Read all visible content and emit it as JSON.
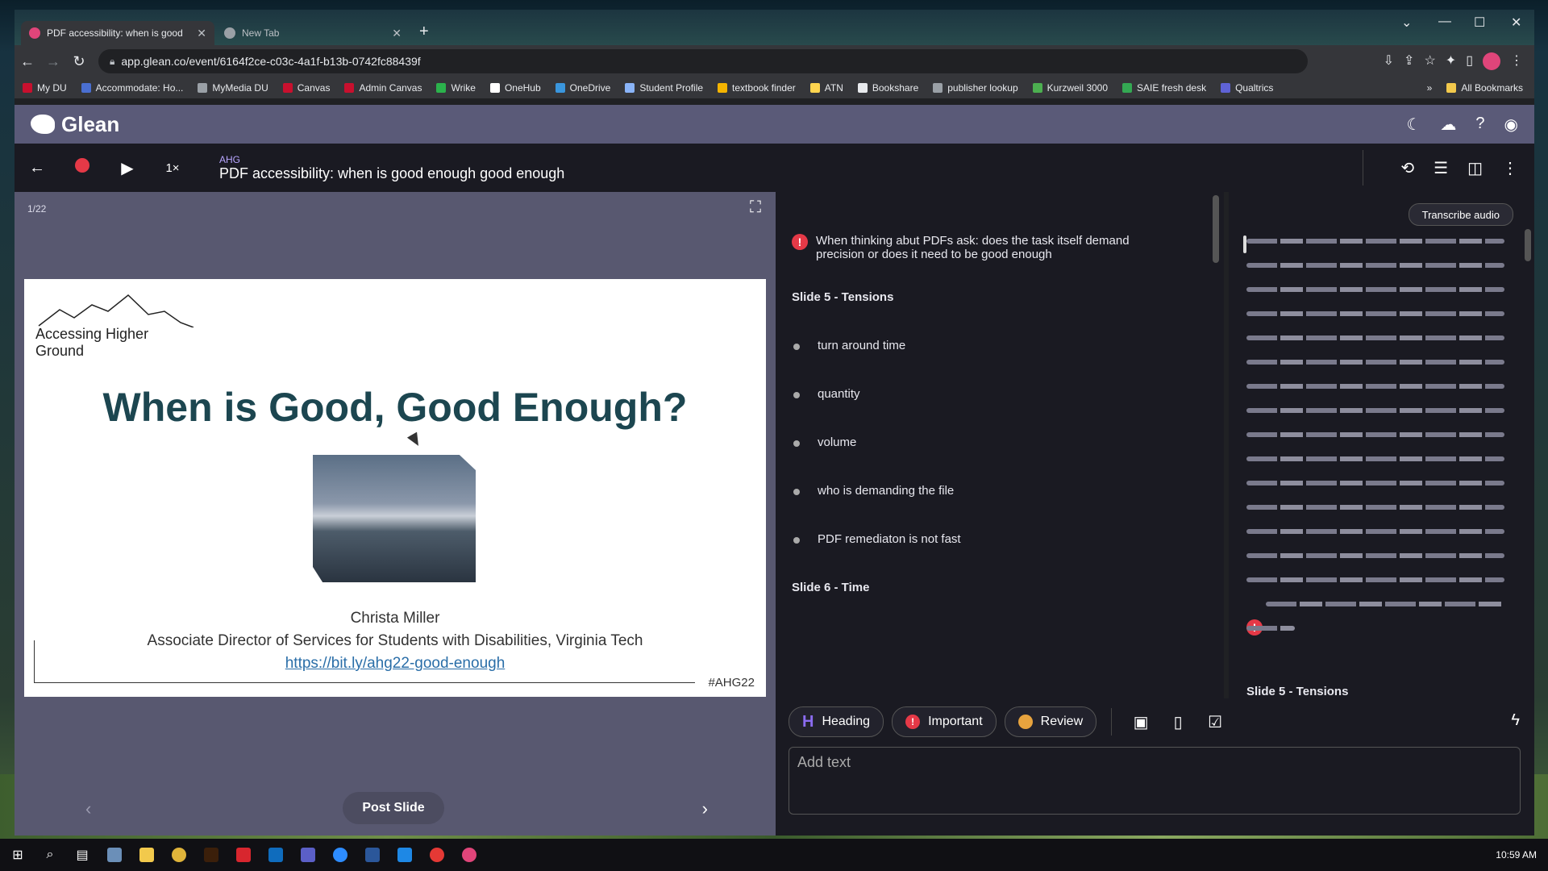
{
  "browser": {
    "tabs": [
      {
        "title": "PDF accessibility: when is good",
        "active": true
      },
      {
        "title": "New Tab",
        "active": false
      }
    ],
    "url": "app.glean.co/event/6164f2ce-c03c-4a1f-b13b-0742fc88439f",
    "bookmarks": [
      "My DU",
      "Accommodate: Ho...",
      "MyMedia DU",
      "Canvas",
      "Admin Canvas",
      "Wrike",
      "OneHub",
      "OneDrive",
      "Student Profile",
      "textbook finder",
      "ATN",
      "Bookshare",
      "publisher lookup",
      "Kurzweil 3000",
      "SAIE fresh desk",
      "Qualtrics"
    ],
    "all_bookmarks": "All Bookmarks",
    "more_bookmarks": "»"
  },
  "app": {
    "name": "Glean",
    "event_tag": "AHG",
    "event_title": "PDF accessibility: when is good enough good enough",
    "speed": "1×"
  },
  "slide": {
    "counter": "1/22",
    "logo_text": "Accessing Higher Ground",
    "title": "When is Good, Good Enough?",
    "author": "Christa Miller",
    "role": "Associate Director of Services for Students with Disabilities, Virginia Tech",
    "link": "https://bit.ly/ahg22-good-enough",
    "hashtag": "#AHG22",
    "post_slide_label": "Post Slide"
  },
  "notes": {
    "important_note": "When thinking abut PDFs ask: does the task itself demand precision or does it need to be good enough",
    "heading1": "Slide 5 - Tensions",
    "bullets": [
      "turn around time",
      "quantity",
      "volume",
      "who is demanding the file",
      "PDF remediaton is not fast"
    ],
    "heading2": "Slide 6 - Time"
  },
  "waveform": {
    "transcribe_label": "Transcribe audio",
    "footer_heading": "Slide 5 - Tensions"
  },
  "editor": {
    "heading_label": "Heading",
    "important_label": "Important",
    "review_label": "Review",
    "placeholder": "Add text"
  },
  "taskbar": {
    "time": "10:59 AM"
  },
  "colors": {
    "accent_purple": "#8b6cf0",
    "record_red": "#e53947",
    "header_bg": "#5a5a78"
  }
}
